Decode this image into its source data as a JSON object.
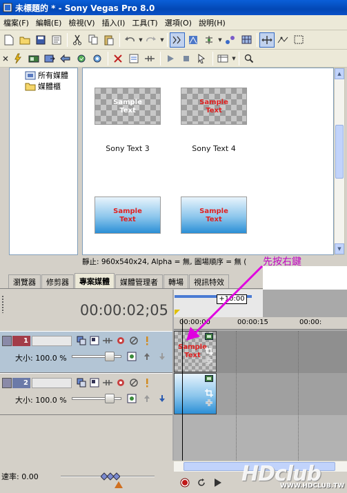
{
  "window": {
    "title": "未標題的 * - Sony Vegas Pro 8.0"
  },
  "menu": [
    "檔案(F)",
    "編輯(E)",
    "檢視(V)",
    "插入(I)",
    "工具(T)",
    "選項(O)",
    "說明(H)"
  ],
  "tree": {
    "items": [
      {
        "label": "所有媒體",
        "icon": "film-folder-icon"
      },
      {
        "label": "媒體櫃",
        "icon": "folder-icon"
      }
    ]
  },
  "media": {
    "items": [
      {
        "caption": "Sony Text 3",
        "thumb_text": "Sample\nText",
        "style": "checker-white"
      },
      {
        "caption": "Sony Text 4",
        "thumb_text": "Sample\nText",
        "style": "checker-red"
      },
      {
        "caption": "",
        "thumb_text": "Sample\nText",
        "style": "blue-red"
      },
      {
        "caption": "",
        "thumb_text": "Sample\nText",
        "style": "blue-red"
      }
    ]
  },
  "status": {
    "info": "靜止: 960x540x24, Alpha = 無, 圖場順序 = 無 ("
  },
  "annotation": {
    "text": "先按右鍵",
    "color": "#c000c0"
  },
  "tabs": [
    {
      "label": "瀏覽器",
      "active": false
    },
    {
      "label": "修剪器",
      "active": false
    },
    {
      "label": "專案媒體",
      "active": true
    },
    {
      "label": "媒體管理者",
      "active": false
    },
    {
      "label": "轉場",
      "active": false
    },
    {
      "label": "視訊特效",
      "active": false
    }
  ],
  "timeline": {
    "timecode": "00:00:02;05",
    "marker": "+10:00",
    "ruler_labels": [
      "00:00:00",
      "00:00:15",
      "00:00:"
    ],
    "tracks": [
      {
        "number": "1",
        "size_label": "大小: 100.0 %",
        "selected": true,
        "clip_text": "Sample\nText"
      },
      {
        "number": "2",
        "size_label": "大小: 100.0 %",
        "selected": false,
        "clip_text": ""
      }
    ]
  },
  "rate": {
    "label": "速率: 0.00"
  },
  "watermark": {
    "logo": "HDclub",
    "url": "WWW.HDCLUB.TW"
  }
}
